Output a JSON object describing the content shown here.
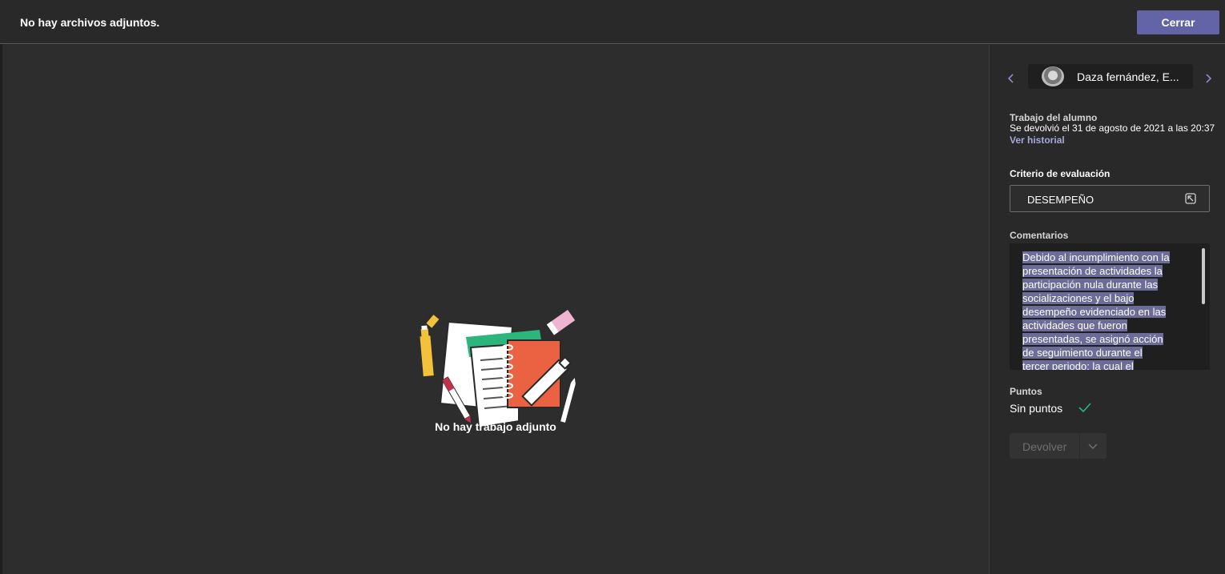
{
  "header": {
    "title": "No hay archivos adjuntos.",
    "close_label": "Cerrar",
    "accent": "#6264a7"
  },
  "main": {
    "empty_message": "No hay trabajo adjunto",
    "illustration_icon": "notebook-and-pencils-illustration"
  },
  "side": {
    "prev_icon": "chevron-left-icon",
    "next_icon": "chevron-right-icon",
    "student_name": "Daza fernández, E...",
    "work_label": "Trabajo del alumno",
    "returned_text": "Se devolvió el 31 de agosto de 2021 a las 20:37",
    "history_link": "Ver historial",
    "rubric_label": "Criterio de evaluación",
    "rubric_value": "DESEMPEÑO",
    "comments_label": "Comentarios",
    "comment_lines": [
      "Debido al incumplimiento con la",
      "presentación de actividades la",
      "participación nula durante las",
      "socializaciones y el bajo",
      "desempeño evidenciado en las",
      "actividades que fueron",
      "presentadas, se asignó acción",
      "de seguimiento durante el",
      "tercer periodo; la cual el"
    ],
    "points_label": "Puntos",
    "points_value": "Sin puntos",
    "return_label": "Devolver"
  }
}
